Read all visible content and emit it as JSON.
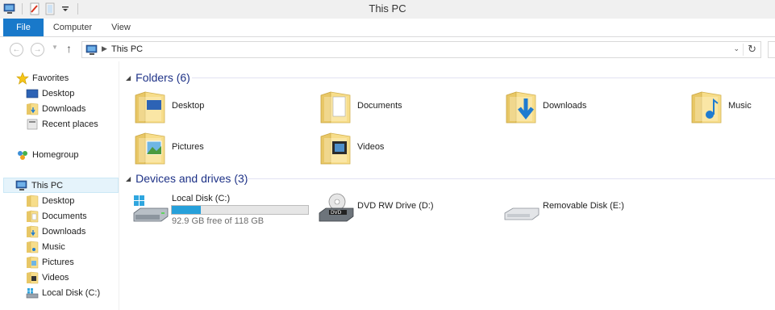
{
  "window": {
    "title": "This PC"
  },
  "ribbon": {
    "tabs": [
      "File",
      "Computer",
      "View"
    ]
  },
  "address": {
    "path": "This PC"
  },
  "navpane": {
    "favorites": {
      "label": "Favorites",
      "items": [
        "Desktop",
        "Downloads",
        "Recent places"
      ]
    },
    "homegroup": {
      "label": "Homegroup"
    },
    "thispc": {
      "label": "This PC",
      "items": [
        "Desktop",
        "Documents",
        "Downloads",
        "Music",
        "Pictures",
        "Videos",
        "Local Disk (C:)"
      ]
    }
  },
  "folders": {
    "title": "Folders (6)",
    "items": [
      "Desktop",
      "Documents",
      "Downloads",
      "Music",
      "Pictures",
      "Videos"
    ]
  },
  "drives": {
    "title": "Devices and drives (3)",
    "local": {
      "label": "Local Disk (C:)",
      "free_text": "92.9 GB free of 118 GB",
      "used_fraction": 0.213
    },
    "dvd": {
      "label": "DVD RW Drive (D:)"
    },
    "removable": {
      "label": "Removable Disk (E:)"
    }
  },
  "colors": {
    "accent": "#1979ca",
    "group_title": "#1e3287",
    "usage_bar": "#26a0da"
  }
}
